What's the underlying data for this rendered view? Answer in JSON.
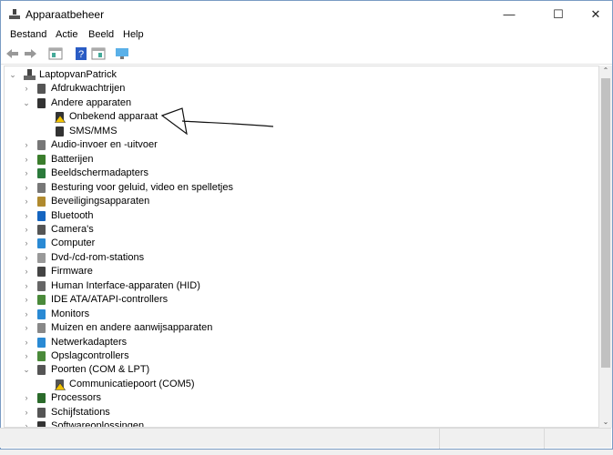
{
  "window": {
    "title": "Apparaatbeheer",
    "minimize": "—",
    "maximize": "☐",
    "close": "✕"
  },
  "menu": [
    "Bestand",
    "Actie",
    "Beeld",
    "Help"
  ],
  "toolbar": [
    "back-icon",
    "forward-icon",
    "show-hide-console-tree-icon",
    "help-icon",
    "properties-icon",
    "scan-hardware-icon"
  ],
  "tree": {
    "root": "LaptopvanPatrick",
    "items": [
      {
        "label": "Afdrukwachtrijen",
        "level": 1,
        "expanded": false,
        "icon": "printer-icon",
        "color": "#555"
      },
      {
        "label": "Andere apparaten",
        "level": 1,
        "expanded": true,
        "icon": "unknown-device-icon",
        "color": "#333"
      },
      {
        "label": "Onbekend apparaat",
        "level": 2,
        "icon": "warning-device-icon",
        "color": "#333",
        "warning": true
      },
      {
        "label": "SMS/MMS",
        "level": 2,
        "icon": "unknown-device-icon",
        "color": "#333"
      },
      {
        "label": "Audio-invoer en -uitvoer",
        "level": 1,
        "expanded": false,
        "icon": "speaker-icon",
        "color": "#777"
      },
      {
        "label": "Batterijen",
        "level": 1,
        "expanded": false,
        "icon": "battery-icon",
        "color": "#3a7d2c"
      },
      {
        "label": "Beeldschermadapters",
        "level": 1,
        "expanded": false,
        "icon": "display-adapter-icon",
        "color": "#2b7a3b"
      },
      {
        "label": "Besturing voor geluid, video en spelletjes",
        "level": 1,
        "expanded": false,
        "icon": "sound-icon",
        "color": "#777"
      },
      {
        "label": "Beveiligingsapparaten",
        "level": 1,
        "expanded": false,
        "icon": "key-icon",
        "color": "#b08a2e"
      },
      {
        "label": "Bluetooth",
        "level": 1,
        "expanded": false,
        "icon": "bluetooth-icon",
        "color": "#1565c0"
      },
      {
        "label": "Camera's",
        "level": 1,
        "expanded": false,
        "icon": "camera-icon",
        "color": "#555"
      },
      {
        "label": "Computer",
        "level": 1,
        "expanded": false,
        "icon": "computer-icon",
        "color": "#2a8ad4"
      },
      {
        "label": "Dvd-/cd-rom-stations",
        "level": 1,
        "expanded": false,
        "icon": "dvd-icon",
        "color": "#999"
      },
      {
        "label": "Firmware",
        "level": 1,
        "expanded": false,
        "icon": "firmware-icon",
        "color": "#444"
      },
      {
        "label": "Human Interface-apparaten (HID)",
        "level": 1,
        "expanded": false,
        "icon": "hid-icon",
        "color": "#666"
      },
      {
        "label": "IDE ATA/ATAPI-controllers",
        "level": 1,
        "expanded": false,
        "icon": "ide-controller-icon",
        "color": "#4a8a3a"
      },
      {
        "label": "Monitors",
        "level": 1,
        "expanded": false,
        "icon": "monitor-icon",
        "color": "#2a8ad4"
      },
      {
        "label": "Muizen en andere aanwijsapparaten",
        "level": 1,
        "expanded": false,
        "icon": "mouse-icon",
        "color": "#888"
      },
      {
        "label": "Netwerkadapters",
        "level": 1,
        "expanded": false,
        "icon": "network-icon",
        "color": "#2a8ad4"
      },
      {
        "label": "Opslagcontrollers",
        "level": 1,
        "expanded": false,
        "icon": "storage-controller-icon",
        "color": "#4a8a3a"
      },
      {
        "label": "Poorten (COM & LPT)",
        "level": 1,
        "expanded": true,
        "icon": "port-icon",
        "color": "#555"
      },
      {
        "label": "Communicatiepoort (COM5)",
        "level": 2,
        "icon": "warning-port-icon",
        "color": "#555",
        "warning": true
      },
      {
        "label": "Processors",
        "level": 1,
        "expanded": false,
        "icon": "processor-icon",
        "color": "#2b6b2b"
      },
      {
        "label": "Schijfstations",
        "level": 1,
        "expanded": false,
        "icon": "disk-drive-icon",
        "color": "#555"
      },
      {
        "label": "Softwareoplossingen",
        "level": 1,
        "expanded": false,
        "icon": "software-icon",
        "color": "#333"
      }
    ]
  }
}
